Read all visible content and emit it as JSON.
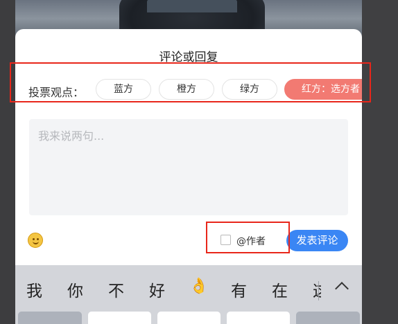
{
  "dialog": {
    "title": "评论或回复"
  },
  "vote": {
    "label": "投票观点：",
    "options": [
      {
        "label": "蓝方",
        "selected": false
      },
      {
        "label": "橙方",
        "selected": false
      },
      {
        "label": "绿方",
        "selected": false
      },
      {
        "label": "红方：选方者",
        "selected": true
      }
    ]
  },
  "comment": {
    "placeholder": "我来说两句...",
    "emoji_icon": "smile-emoji-icon",
    "mention_author_label": "@作者",
    "mention_author_checked": false,
    "submit_label": "发表评论"
  },
  "keyboard": {
    "candidates": [
      "我",
      "你",
      "不",
      "好",
      "👌",
      "有",
      "在",
      "这"
    ],
    "expand_icon": "chevron-up-icon"
  },
  "colors": {
    "accent_blue": "#3a86f4",
    "selected_red": "#f27a72",
    "annotation_red": "#e8261a",
    "input_bg": "#f3f4f6",
    "keyboard_bg": "#d3d5da"
  }
}
